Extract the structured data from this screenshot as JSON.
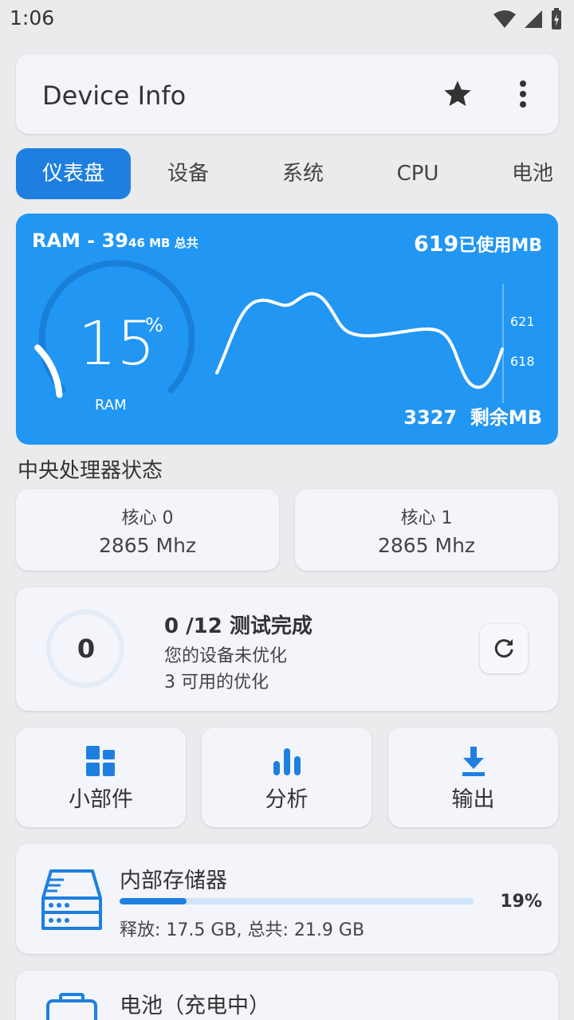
{
  "status_bar": {
    "time": "1:06"
  },
  "app_bar": {
    "title": "Device Info"
  },
  "tabs": [
    {
      "label": "仪表盘",
      "active": true
    },
    {
      "label": "设备",
      "active": false
    },
    {
      "label": "系统",
      "active": false
    },
    {
      "label": "CPU",
      "active": false
    },
    {
      "label": "电池",
      "active": false
    }
  ],
  "ram": {
    "title": "RAM - 39",
    "title_small": "46 MB 总共",
    "used_value": "619",
    "used_unit": "已使用MB",
    "percent": "15",
    "percent_sign": "%",
    "label": "RAM",
    "free_value": "3327",
    "free_unit": "剩余MB",
    "usage_fraction": 0.15,
    "ticks": [
      "621",
      "618"
    ]
  },
  "cpu_section": {
    "title": "中央处理器状态",
    "cores": [
      {
        "name": "核心 0",
        "freq": "2865 Mhz"
      },
      {
        "name": "核心 1",
        "freq": "2865 Mhz"
      }
    ]
  },
  "optimize": {
    "count": "0",
    "title": "0 /12 测试完成",
    "line1": "您的设备未优化",
    "line2": "3 可用的优化"
  },
  "actions": [
    {
      "label": "小部件",
      "icon": "widgets-icon"
    },
    {
      "label": "分析",
      "icon": "bar-chart-icon"
    },
    {
      "label": "输出",
      "icon": "download-icon"
    }
  ],
  "storage": {
    "title": "内部存储器",
    "percent": "19%",
    "fraction": 0.19,
    "detail": "释放: 17.5 GB,  总共: 21.9 GB"
  },
  "battery": {
    "title": "电池（充电中）"
  },
  "colors": {
    "accent": "#1e7fe0",
    "ram_card": "#2196f3",
    "background": "#ebebed",
    "card": "#f3f5fb"
  }
}
